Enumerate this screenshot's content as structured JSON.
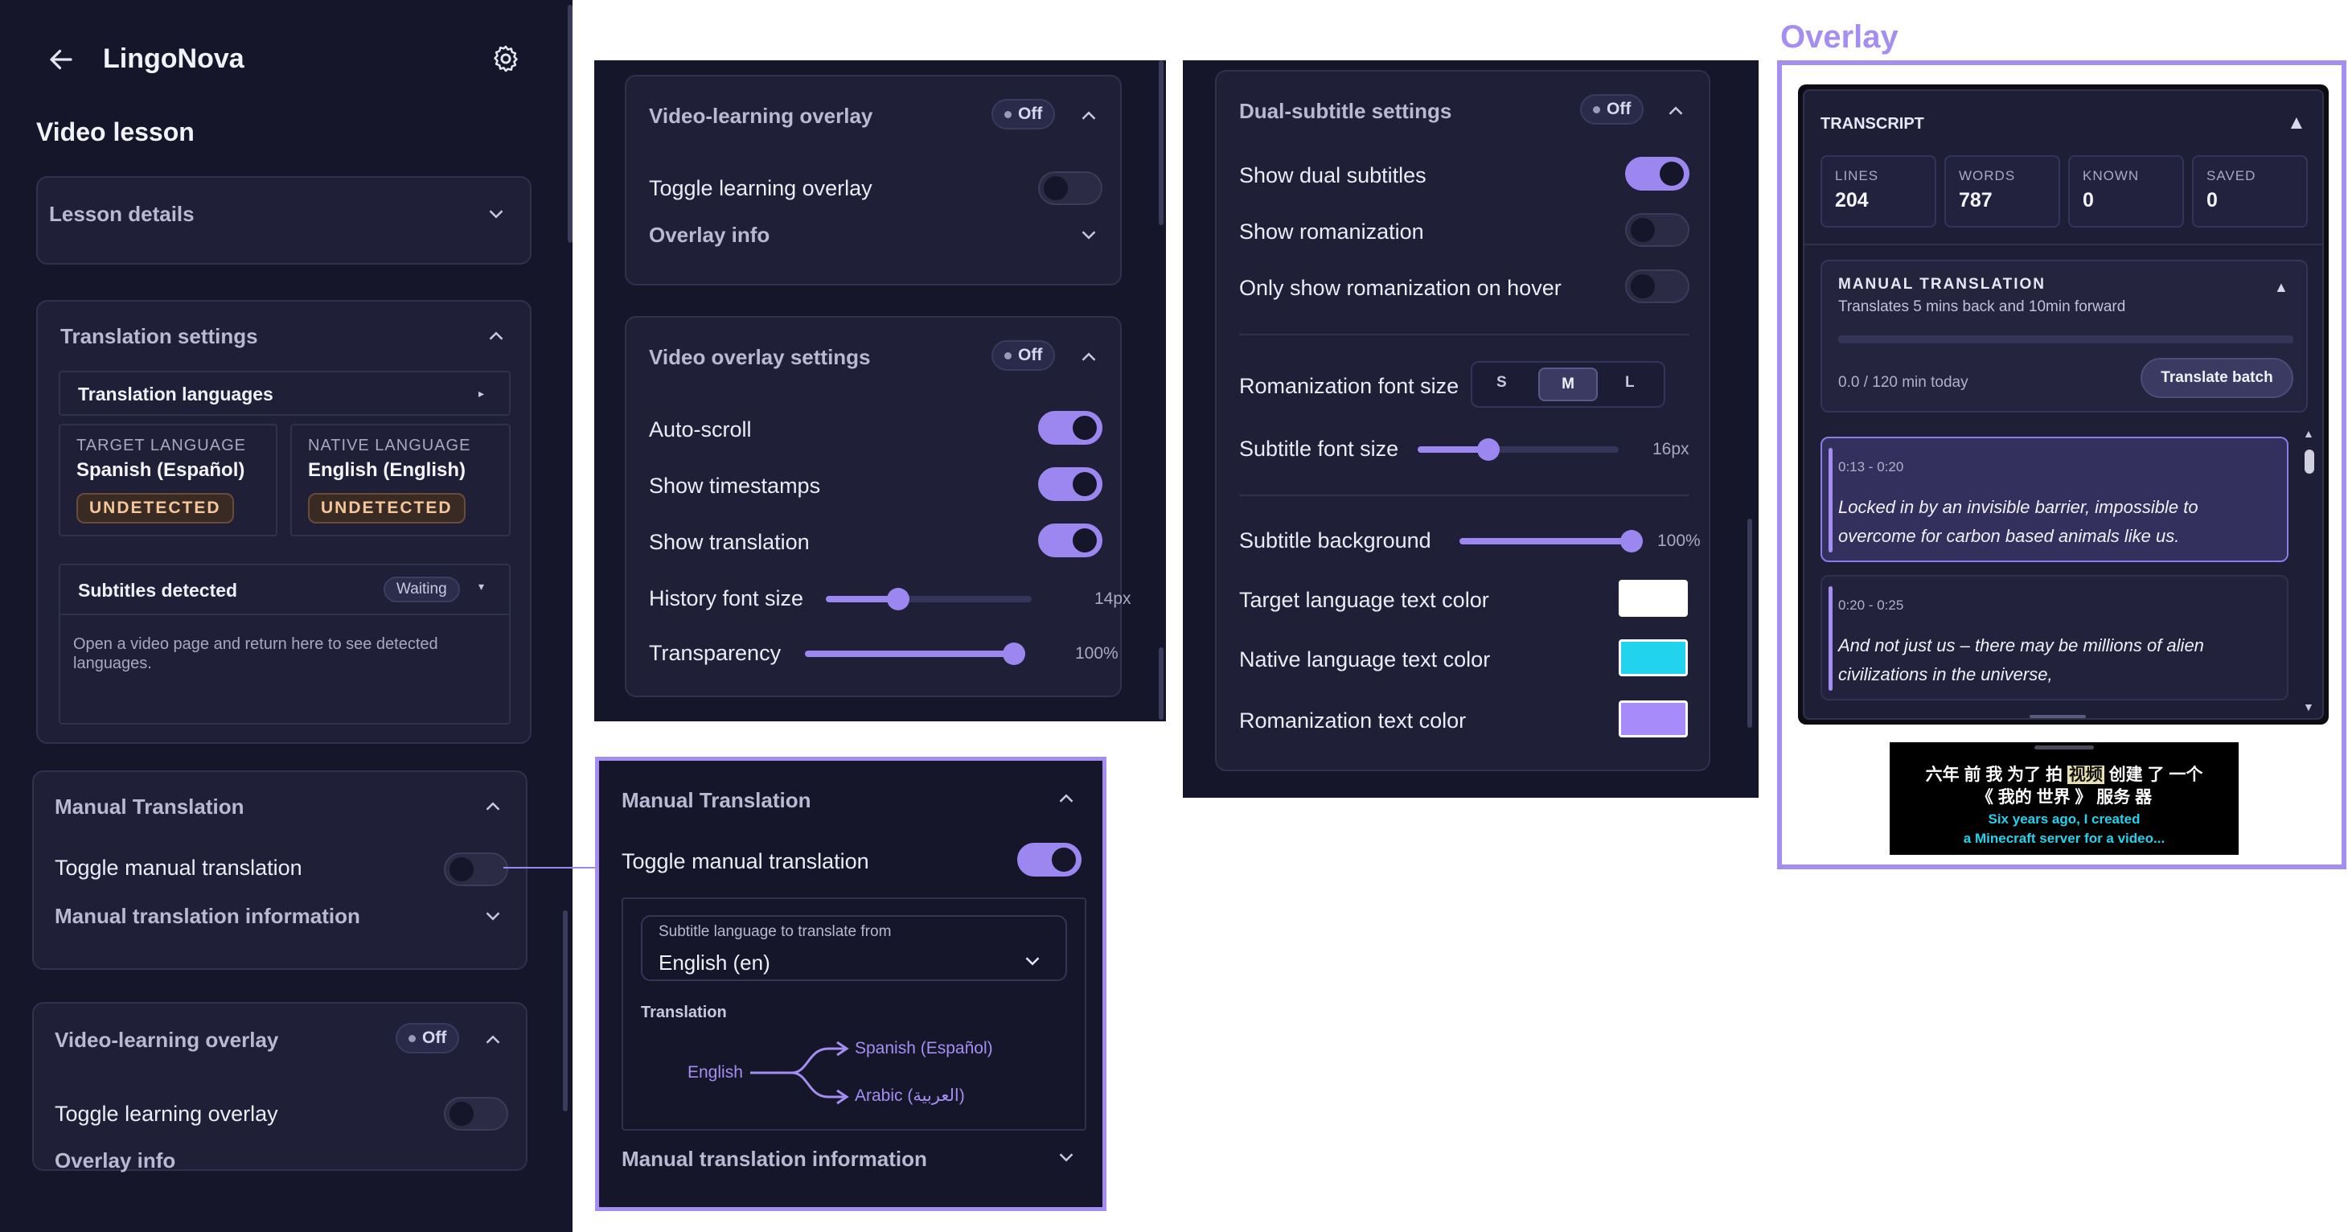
{
  "app": {
    "title": "LingoNova",
    "page_title": "Video lesson"
  },
  "lesson_details": {
    "title": "Lesson details"
  },
  "translation_settings": {
    "title": "Translation settings",
    "languages_title": "Translation languages",
    "target_label": "TARGET LANGUAGE",
    "target_value": "Spanish (Español)",
    "target_status": "UNDETECTED",
    "native_label": "NATIVE LANGUAGE",
    "native_value": "English (English)",
    "native_status": "UNDETECTED",
    "subtitles_title": "Subtitles detected",
    "subtitles_status": "Waiting",
    "subtitles_help": "Open a video page and return here to see detected languages."
  },
  "manual_translation": {
    "title": "Manual Translation",
    "toggle_label": "Toggle manual translation",
    "info_label": "Manual translation information",
    "toggle_on": false
  },
  "video_learning_overlay": {
    "title": "Video-learning overlay",
    "status": "Off",
    "toggle_label": "Toggle learning overlay",
    "info_label": "Overlay info"
  },
  "video_overlay_settings": {
    "title": "Video overlay settings",
    "status": "Off",
    "auto_scroll": "Auto-scroll",
    "show_timestamps": "Show timestamps",
    "show_translation": "Show translation",
    "history_font_label": "History font size",
    "history_font_value": "14px",
    "history_font_fraction": 0.35,
    "transparency_label": "Transparency",
    "transparency_value": "100%",
    "transparency_fraction": 1.0
  },
  "dual_subtitle": {
    "title": "Dual-subtitle settings",
    "status": "Off",
    "show_dual": "Show dual subtitles",
    "show_romanization": "Show romanization",
    "romanization_hover": "Only show romanization on hover",
    "roman_font_label": "Romanization font size",
    "sizes": [
      "S",
      "M",
      "L"
    ],
    "selected_size": "M",
    "subtitle_font_label": "Subtitle font size",
    "subtitle_font_value": "16px",
    "subtitle_font_fraction": 0.35,
    "background_label": "Subtitle background",
    "background_value": "100%",
    "background_fraction": 1.0,
    "target_color_label": "Target language text color",
    "native_color_label": "Native language text color",
    "roman_color_label": "Romanization text color",
    "target_color": "#ffffff",
    "native_color": "#22d3ee",
    "roman_color": "#a78bfa"
  },
  "manual_translation_expanded": {
    "title": "Manual Translation",
    "toggle_label": "Toggle manual translation",
    "toggle_on": true,
    "select_legend": "Subtitle language to translate from",
    "select_value": "English (en)",
    "translation_label": "Translation",
    "source_lang": "English",
    "target_langs": [
      "Spanish (Español)",
      "Arabic (العربية)"
    ],
    "info_label": "Manual translation information"
  },
  "overlay": {
    "heading": "Overlay",
    "transcript_title": "TRANSCRIPT",
    "stats": [
      {
        "label": "LINES",
        "value": "204"
      },
      {
        "label": "WORDS",
        "value": "787"
      },
      {
        "label": "KNOWN",
        "value": "0"
      },
      {
        "label": "SAVED",
        "value": "0"
      }
    ],
    "manual_title": "MANUAL TRANSLATION",
    "manual_sub": "Translates 5 mins back and 10min forward",
    "usage": "0.0 / 120 min today",
    "usage_fraction": 0.0,
    "translate_button": "Translate batch",
    "lines": [
      {
        "time": "0:13 - 0:20",
        "text": "Locked in by an invisible barrier, impossible  to overcome for carbon based animals like us."
      },
      {
        "time": "0:20 - 0:25",
        "text": "And not just us – there may be millions  of alien civilizations in the universe,"
      }
    ],
    "subtitle_zh_before": "六年 前 我 为了 拍 ",
    "subtitle_zh_highlight": "视频",
    "subtitle_zh_after": " 创建 了 一个",
    "subtitle_zh_line2": "《 我的 世界 》 服务 器",
    "subtitle_en_line1": "Six years ago, I created",
    "subtitle_en_line2": "a Minecraft server for a video..."
  },
  "colors": {
    "accent": "#9c86f0",
    "bg": "#16162a",
    "card": "#1f1f38"
  }
}
